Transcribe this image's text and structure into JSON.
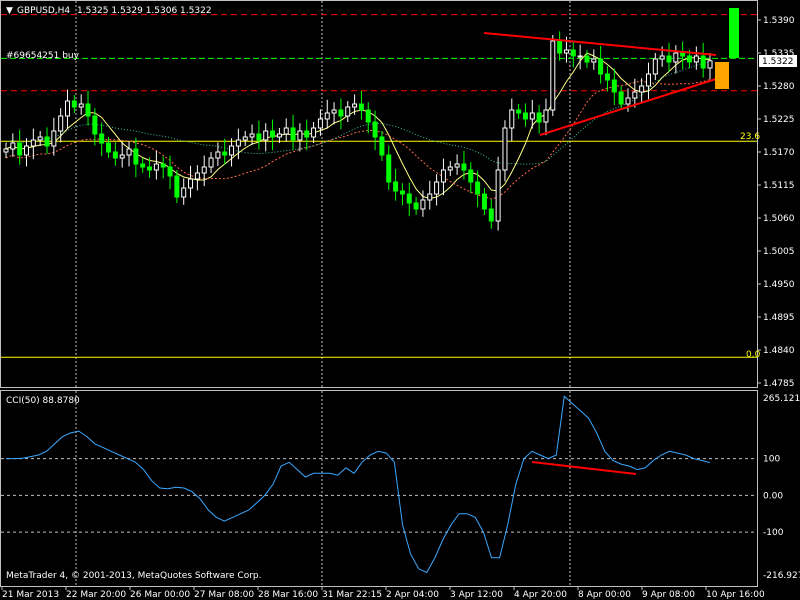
{
  "header": {
    "menu_icon": "triangle-down-icon",
    "symbol_timeframe": "GBPUSD,H4",
    "ohlc": "1.5325 1.5329 1.5306 1.5322"
  },
  "order_label": "#69654251 buy",
  "current_price_badge": "1.5322",
  "fibo": {
    "level_236": "23.6",
    "level_00": "0.0"
  },
  "indicator": {
    "title": "CCI(50) 88.8780",
    "scale": [
      "265.1214",
      "100",
      "0.00",
      "-100",
      "-216.9271"
    ]
  },
  "copyright": "MetaTrader 4, © 2001-2013, MetaQuotes Software Corp.",
  "colors": {
    "background": "#000000",
    "grid": "#c0c0c0",
    "bull_candle": "#ffffff",
    "bear_candle": "#00ff00",
    "trendline": "#ff0000",
    "fibo": "#ffff00",
    "ma_fast": "#ffff80",
    "ma_slow": "#ff6a4a",
    "ma_mid": "#40c0a0",
    "cci_line": "#3ba8ff",
    "buy_box": "#00ff00",
    "sell_box": "#ffa500"
  },
  "chart_data": {
    "type": "candlestick",
    "symbol": "GBPUSD",
    "timeframe": "H4",
    "price_axis": [
      "1.5390",
      "1.5335",
      "1.5280",
      "1.5225",
      "1.5170",
      "1.5115",
      "1.5060",
      "1.5005",
      "1.4950",
      "1.4895",
      "1.4840",
      "1.4785"
    ],
    "time_axis": [
      "21 Mar 2013",
      "22 Mar 20:00",
      "26 Mar 00:00",
      "27 Mar 08:00",
      "28 Mar 16:00",
      "31 Mar 22:15",
      "2 Apr 04:00",
      "3 Apr 12:00",
      "4 Apr 20:00",
      "8 Apr 00:00",
      "9 Apr 08:00",
      "10 Apr 16:00"
    ],
    "close_prices": [
      1.5175,
      1.5185,
      1.5165,
      1.518,
      1.519,
      1.5195,
      1.518,
      1.5205,
      1.523,
      1.5255,
      1.5245,
      1.525,
      1.523,
      1.52,
      1.5185,
      1.517,
      1.516,
      1.5165,
      1.5175,
      1.515,
      1.5145,
      1.514,
      1.515,
      1.5145,
      1.513,
      1.5095,
      1.511,
      1.5125,
      1.5135,
      1.5145,
      1.516,
      1.517,
      1.5165,
      1.518,
      1.519,
      1.5195,
      1.52,
      1.519,
      1.5205,
      1.5195,
      1.52,
      1.521,
      1.519,
      1.5205,
      1.5195,
      1.521,
      1.5225,
      1.5235,
      1.524,
      1.523,
      1.5245,
      1.525,
      1.524,
      1.522,
      1.5195,
      1.5165,
      1.512,
      1.5105,
      1.51,
      1.5085,
      1.5075,
      1.509,
      1.51,
      1.512,
      1.514,
      1.5145,
      1.515,
      1.514,
      1.512,
      1.51,
      1.5075,
      1.5055,
      1.514,
      1.521,
      1.524,
      1.5235,
      1.5225,
      1.5235,
      1.522,
      1.524,
      1.5355,
      1.5335,
      1.534,
      1.533,
      1.533,
      1.532,
      1.5325,
      1.53,
      1.529,
      1.527,
      1.525,
      1.526,
      1.527,
      1.528,
      1.53,
      1.5325,
      1.533,
      1.532,
      1.5335,
      1.533,
      1.532,
      1.533,
      1.531,
      1.5322
    ],
    "cci_values": [
      100,
      100,
      101,
      105,
      110,
      120,
      140,
      160,
      170,
      175,
      160,
      140,
      130,
      120,
      110,
      100,
      90,
      70,
      40,
      20,
      18,
      22,
      20,
      10,
      -10,
      -40,
      -60,
      -70,
      -60,
      -50,
      -40,
      -20,
      0,
      30,
      80,
      90,
      70,
      50,
      60,
      60,
      60,
      55,
      75,
      60,
      90,
      110,
      120,
      115,
      90,
      -80,
      -160,
      -200,
      -210,
      -170,
      -120,
      -80,
      -50,
      -50,
      -60,
      -100,
      -170,
      -170,
      -80,
      30,
      100,
      120,
      110,
      100,
      110,
      270,
      250,
      230,
      210,
      170,
      120,
      95,
      85,
      80,
      70,
      75,
      95,
      110,
      120,
      115,
      110,
      100,
      95,
      89
    ],
    "annotations": {
      "fib_23_6": 1.5188,
      "fib_0_0": 1.4828,
      "red_dashed_top": 1.5399,
      "red_dashed_mid": 1.5272,
      "order_level": 1.5326
    }
  }
}
